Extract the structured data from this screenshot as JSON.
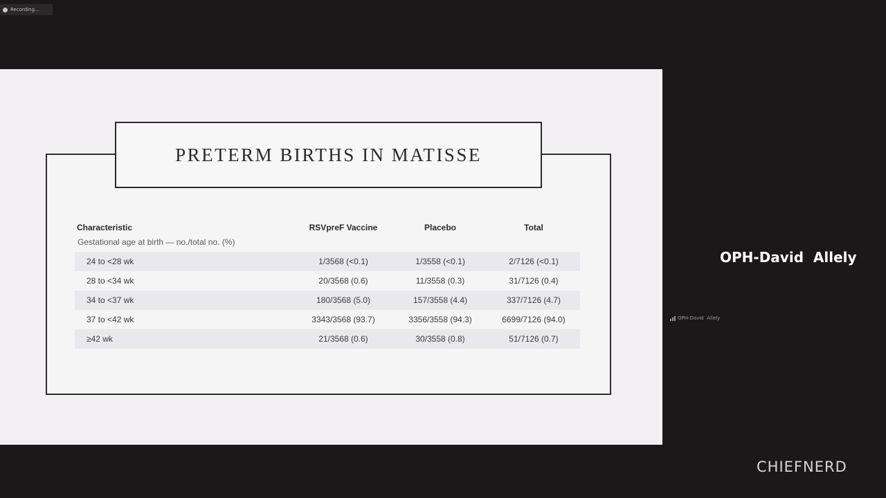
{
  "recording": {
    "label": "Recording..."
  },
  "slide": {
    "title": "PRETERM BIRTHS IN MATISSE",
    "table": {
      "headers": [
        "Characteristic",
        "RSVpreF Vaccine",
        "Placebo",
        "Total"
      ],
      "subheader": "Gestational age at birth — no./total no. (%)",
      "rows": [
        [
          "24 to <28 wk",
          "1/3568 (<0.1)",
          "1/3558 (<0.1)",
          "2/7126 (<0.1)"
        ],
        [
          "28 to <34 wk",
          "20/3568 (0.6)",
          "11/3558 (0.3)",
          "31/7126 (0.4)"
        ],
        [
          "34 to <37 wk",
          "180/3568 (5.0)",
          "157/3558 (4.4)",
          "337/7126 (4.7)"
        ],
        [
          "37 to <42 wk",
          "3343/3568 (93.7)",
          "3356/3558 (94.3)",
          "6699/7126 (94.0)"
        ],
        [
          "≥42 wk",
          "21/3568 (0.6)",
          "30/3558 (0.8)",
          "51/7126 (0.7)"
        ]
      ]
    }
  },
  "participant": {
    "name": "OPH-David  Allely",
    "thumb_label": "OPH-David  Allely",
    "signal_icon": "signal-bars-icon"
  },
  "watermark": "CHIEFNERD"
}
